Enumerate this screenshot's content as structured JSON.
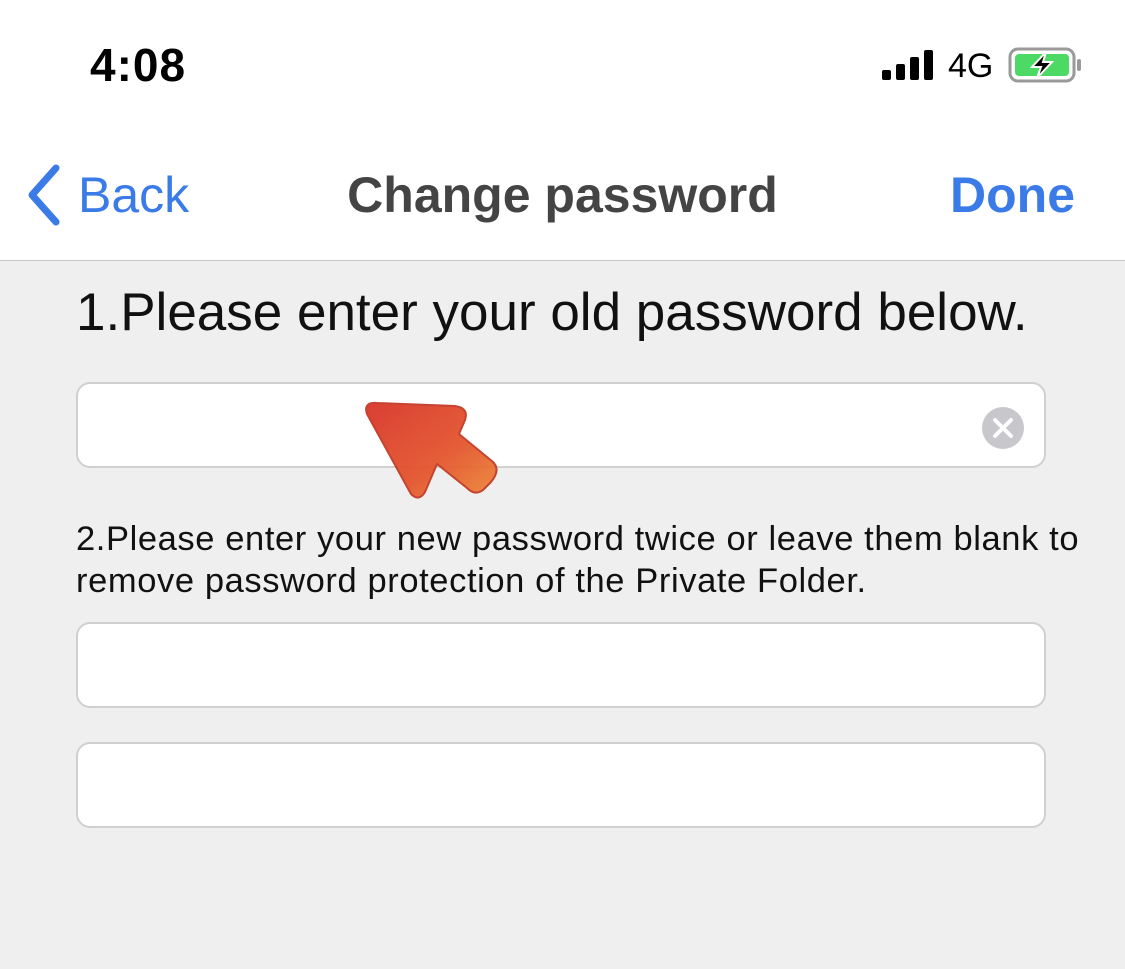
{
  "status_bar": {
    "time": "4:08",
    "network": "4G",
    "icons": [
      "signal-icon",
      "battery-charging-icon"
    ]
  },
  "nav": {
    "back_label": "Back",
    "title": "Change password",
    "done_label": "Done",
    "accent_color": "#3a7be8"
  },
  "form": {
    "instruction_old": "1.Please enter your old password below.",
    "instruction_new": "2.Please enter your new password twice or leave them blank to remove password protection of the Private Folder.",
    "old_password": {
      "value": "",
      "placeholder": ""
    },
    "new_password": {
      "value": "",
      "placeholder": ""
    },
    "confirm_password": {
      "value": "",
      "placeholder": ""
    }
  },
  "overlay": {
    "icon": "pointer-arrow-icon",
    "color": "#d9432b"
  }
}
